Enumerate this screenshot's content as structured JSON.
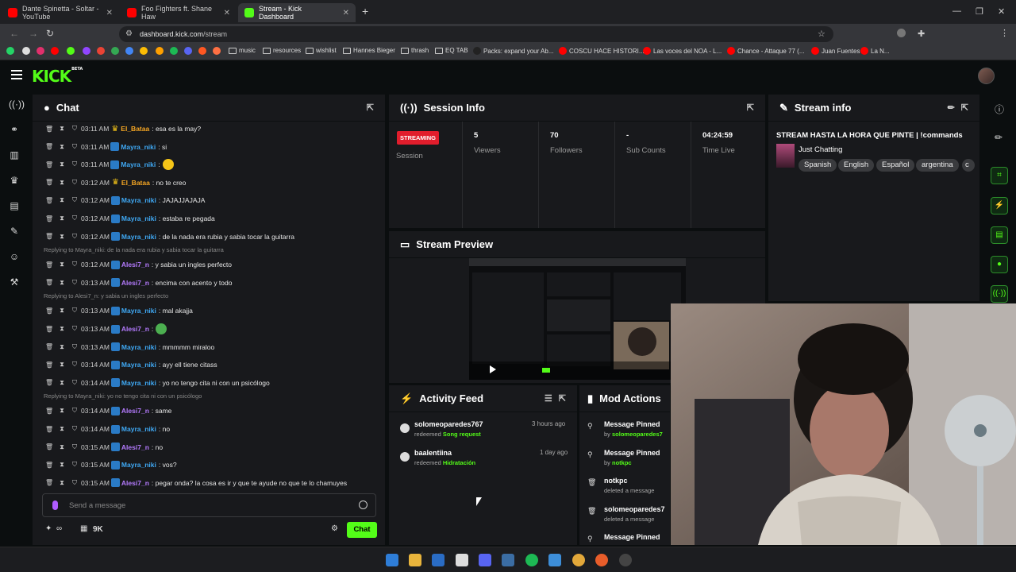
{
  "browser": {
    "tabs": [
      {
        "title": "Dante Spinetta - Soltar - YouTube",
        "fav": "#ff0000"
      },
      {
        "title": "Foo Fighters ft. Shane Haw",
        "fav": "#ff0000"
      },
      {
        "title": "Stream - Kick Dashboard",
        "fav": "#53fc18"
      }
    ],
    "url_domain": "dashboard.kick.com",
    "url_path": "/stream",
    "bookmarks": [
      "music",
      "resources",
      "wishlist",
      "Hannes Bieger",
      "thrash",
      "EQ TAB",
      "Packs: expand your Ab...",
      "COSCU HACE HISTORI...",
      "Las voces del NOA - L...",
      "Chance - Attaque 77 (...",
      "Juan Fuentes",
      "La N..."
    ]
  },
  "kick": {
    "logo": "KICK",
    "beta": "BETA"
  },
  "chat": {
    "title": "Chat",
    "messages": [
      {
        "time": "03:11 AM",
        "user": "El_Bataa",
        "color": "orange",
        "badge": "crown",
        "text": ": esa es la may?"
      },
      {
        "time": "03:11 AM",
        "user": "Mayra_niki",
        "color": "blue",
        "badge": "blue",
        "text": ": si"
      },
      {
        "time": "03:11 AM",
        "user": "Mayra_niki",
        "color": "blue",
        "badge": "blue",
        "text": ":",
        "emote": "#f5c518"
      },
      {
        "time": "03:12 AM",
        "user": "El_Bataa",
        "color": "orange",
        "badge": "crown",
        "text": ": no te creo"
      },
      {
        "time": "03:12 AM",
        "user": "Mayra_niki",
        "color": "blue",
        "badge": "blue",
        "text": ": JAJAJJAJAJA"
      },
      {
        "time": "03:12 AM",
        "user": "Mayra_niki",
        "color": "blue",
        "badge": "blue",
        "text": ": estaba re pegada"
      },
      {
        "time": "03:12 AM",
        "user": "Mayra_niki",
        "color": "blue",
        "badge": "blue",
        "text": ": de la nada era rubia y sabia tocar la guitarra"
      },
      {
        "reply": "Replying to Mayra_niki: de la nada era rubia y sabia tocar la guitarra"
      },
      {
        "time": "03:12 AM",
        "user": "Alesi7_n",
        "color": "purple",
        "badge": "blue",
        "text": ": y sabia un ingles perfecto"
      },
      {
        "time": "03:13 AM",
        "user": "Alesi7_n",
        "color": "purple",
        "badge": "blue",
        "text": ": encima con acento y todo"
      },
      {
        "reply": "Replying to Alesi7_n: y sabia un ingles perfecto"
      },
      {
        "time": "03:13 AM",
        "user": "Mayra_niki",
        "color": "blue",
        "badge": "blue",
        "text": ": mal akajja"
      },
      {
        "time": "03:13 AM",
        "user": "Alesi7_n",
        "color": "purple",
        "badge": "blue",
        "text": ":",
        "emote": "#4caf50"
      },
      {
        "time": "03:13 AM",
        "user": "Mayra_niki",
        "color": "blue",
        "badge": "blue",
        "text": ": mmmmm miraloo"
      },
      {
        "time": "03:14 AM",
        "user": "Mayra_niki",
        "color": "blue",
        "badge": "blue",
        "text": ": ayy ell tiene citass"
      },
      {
        "time": "03:14 AM",
        "user": "Mayra_niki",
        "color": "blue",
        "badge": "blue",
        "text": ": yo no tengo cita ni con un psicólogo"
      },
      {
        "reply": "Replying to Mayra_niki: yo no tengo cita ni con un psicólogo"
      },
      {
        "time": "03:14 AM",
        "user": "Alesi7_n",
        "color": "purple",
        "badge": "blue",
        "text": ": same"
      },
      {
        "time": "03:14 AM",
        "user": "Mayra_niki",
        "color": "blue",
        "badge": "blue",
        "text": ": no"
      },
      {
        "time": "03:15 AM",
        "user": "Alesi7_n",
        "color": "purple",
        "badge": "blue",
        "text": ": no"
      },
      {
        "time": "03:15 AM",
        "user": "Mayra_niki",
        "color": "blue",
        "badge": "blue",
        "text": ": vos?"
      },
      {
        "time": "03:15 AM",
        "user": "Alesi7_n",
        "color": "purple",
        "badge": "blue",
        "text": ": pegar onda? la cosa es ir y que te ayude no que te lo chamuyes"
      }
    ],
    "placeholder": "Send a message",
    "points": "∞",
    "kicks": "9K",
    "send_label": "Chat"
  },
  "session": {
    "title": "Session Info",
    "status": "STREAMING",
    "session_label": "Session",
    "stats": [
      {
        "value": "5",
        "label": "Viewers"
      },
      {
        "value": "70",
        "label": "Followers"
      },
      {
        "value": "-",
        "label": "Sub Counts"
      },
      {
        "value": "04:24:59",
        "label": "Time Live"
      }
    ]
  },
  "preview": {
    "title": "Stream Preview"
  },
  "activity": {
    "title": "Activity Feed",
    "items": [
      {
        "user": "solomeoparedes767",
        "action": "redeemed",
        "reward": "Song request",
        "ago": "3 hours ago"
      },
      {
        "user": "baalentiina",
        "action": "redeemed",
        "reward": "Hidratación",
        "ago": "1 day ago"
      }
    ]
  },
  "mod": {
    "title": "Mod Actions",
    "items": [
      {
        "icon": "pin",
        "title": "Message Pinned",
        "by": "by",
        "who": "solomeoparedes7"
      },
      {
        "icon": "pin",
        "title": "Message Pinned",
        "by": "by",
        "who": "notkpc"
      },
      {
        "icon": "trash",
        "title": "notkpc",
        "sub": "deleted a message"
      },
      {
        "icon": "trash",
        "title": "solomeoparedes7",
        "sub": "deleted a message"
      },
      {
        "icon": "pin",
        "title": "Message Pinned"
      }
    ]
  },
  "stream_info": {
    "title": "Stream info",
    "stream_title": "STREAM HASTA LA HORA QUE PINTE | !commands",
    "category": "Just Chatting",
    "tags": [
      "Spanish",
      "English",
      "Español",
      "argentina",
      "c"
    ]
  }
}
